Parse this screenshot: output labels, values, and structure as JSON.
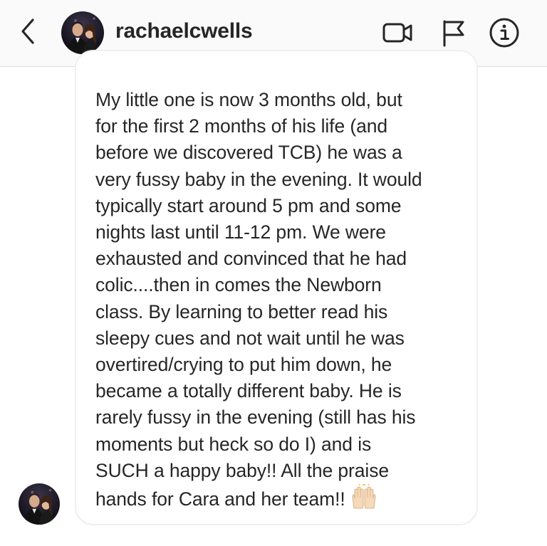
{
  "header": {
    "username": "rachaelcwells",
    "icons": {
      "back": "chevron-left-icon",
      "video": "video-call-icon",
      "flag": "flag-icon",
      "info": "info-icon"
    }
  },
  "message": {
    "text": "My little one is now 3 months old, but\nfor the first 2 months of his life (and\nbefore we discovered TCB) he was a\nvery fussy baby in the evening. It would\ntypically start around 5 pm and some\nnights last until 11-12 pm. We were\nexhausted and convinced that he had\ncolic....then in comes the Newborn\nclass. By learning to better read his\nsleepy cues and not wait until he was\novertired/crying to put him down, he\nbecame a totally different baby. He is\nrarely fussy in the evening (still has his\nmoments but heck so do I) and is\nSUCH a happy baby!! All the praise\nhands for Cara and her team!!",
    "emoji": "raised-hands-emoji"
  },
  "colors": {
    "header_bg": "#fafafa",
    "text": "#262626",
    "bubble_border": "#efefef",
    "divider": "#dbdbdb"
  }
}
